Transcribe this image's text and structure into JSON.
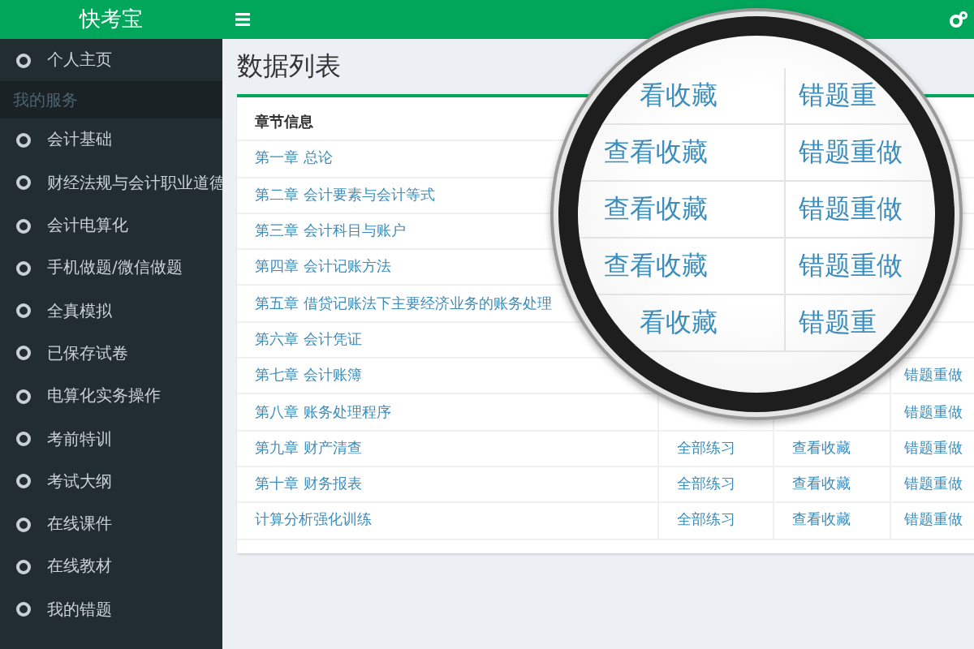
{
  "sidebar": {
    "brand": "快考宝",
    "items": [
      {
        "kind": "item",
        "label": "个人主页"
      },
      {
        "kind": "header",
        "label": "我的服务"
      },
      {
        "kind": "item",
        "label": "会计基础"
      },
      {
        "kind": "item",
        "label": "财经法规与会计职业道德"
      },
      {
        "kind": "item",
        "label": "会计电算化"
      },
      {
        "kind": "item",
        "label": "手机做题/微信做题"
      },
      {
        "kind": "item",
        "label": "全真模拟"
      },
      {
        "kind": "item",
        "label": "已保存试卷"
      },
      {
        "kind": "item",
        "label": "电算化实务操作"
      },
      {
        "kind": "item",
        "label": "考前特训"
      },
      {
        "kind": "item",
        "label": "考试大纲"
      },
      {
        "kind": "item",
        "label": "在线课件"
      },
      {
        "kind": "item",
        "label": "在线教材"
      },
      {
        "kind": "item",
        "label": "我的错题"
      }
    ]
  },
  "page_title": "数据列表",
  "table": {
    "columns": [
      "章节信息"
    ],
    "rows": [
      {
        "chapter": "第一章 总论"
      },
      {
        "chapter": "第二章 会计要素与会计等式"
      },
      {
        "chapter": "第三章 会计科目与账户"
      },
      {
        "chapter": "第四章 会计记账方法"
      },
      {
        "chapter": "第五章 借贷记账法下主要经济业务的账务处理"
      },
      {
        "chapter": "第六章 会计凭证"
      },
      {
        "chapter": "第七章 会计账簿",
        "redo": "错题重做"
      },
      {
        "chapter": "第八章 账务处理程序",
        "redo": "错题重做"
      },
      {
        "chapter": "第九章 财产清查",
        "practice": "全部练习",
        "favorites": "查看收藏",
        "redo": "错题重做"
      },
      {
        "chapter": "第十章 财务报表",
        "practice": "全部练习",
        "favorites": "查看收藏",
        "redo": "错题重做"
      },
      {
        "chapter": "计算分析强化训练",
        "practice": "全部练习",
        "favorites": "查看收藏",
        "redo": "错题重做"
      }
    ]
  },
  "magnifier": {
    "rows": [
      {
        "favorites": "看收藏",
        "redo": "错题重"
      },
      {
        "favorites": "查看收藏",
        "redo": "错题重做"
      },
      {
        "favorites": "查看收藏",
        "redo": "错题重做"
      },
      {
        "favorites": "查看收藏",
        "redo": "错题重做"
      },
      {
        "favorites": "看收藏",
        "redo": "错题重"
      }
    ]
  }
}
